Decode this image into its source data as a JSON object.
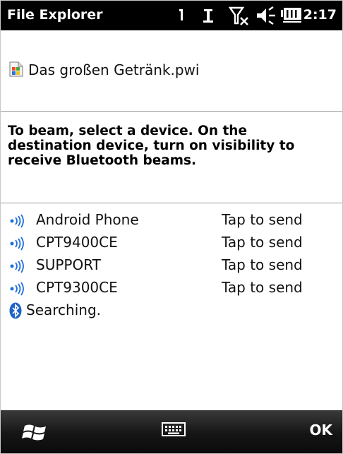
{
  "status_bar": {
    "app_title": "File Explorer",
    "clock": "2:17",
    "icons": [
      "network-icon",
      "signal-antenna-icon",
      "no-signal-icon",
      "speaker-icon",
      "battery-icon"
    ]
  },
  "file": {
    "icon": "document-icon",
    "name": "Das großen Getränk.pwi"
  },
  "instruction": {
    "lines": [
      "To beam, select a device. On the",
      "destination device, turn on visibility to",
      "receive Bluetooth beams."
    ]
  },
  "devices": [
    {
      "name": "Android Phone",
      "action": "Tap to send",
      "icon": "bluetooth-signal-icon"
    },
    {
      "name": "CPT9400CE",
      "action": "Tap to send",
      "icon": "bluetooth-signal-icon"
    },
    {
      "name": "SUPPORT",
      "action": "Tap to send",
      "icon": "bluetooth-signal-icon"
    },
    {
      "name": "CPT9300CE",
      "action": "Tap to send",
      "icon": "bluetooth-signal-icon"
    }
  ],
  "searching": {
    "label": "Searching.",
    "icon": "bluetooth-icon"
  },
  "bottom_bar": {
    "start_icon": "windows-start-icon",
    "keyboard_icon": "keyboard-icon",
    "ok_label": "OK"
  },
  "colors": {
    "status_bg": "#000000",
    "bar_bg": "#151515",
    "signal_blue": "#1e6fd9",
    "bluetooth_blue": "#1d63c9"
  }
}
